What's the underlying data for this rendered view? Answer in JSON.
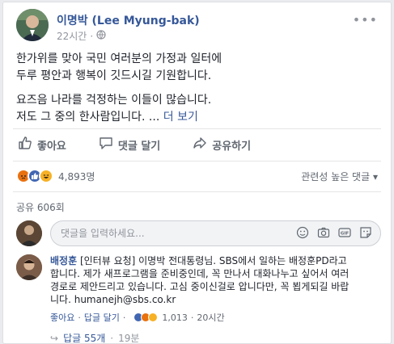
{
  "post": {
    "author": "이명박 (Lee Myung-bak)",
    "time": "22시간",
    "text_lines_p1": [
      "한가위를 맞아 국민 여러분의 가정과 일터에",
      "두루 평안과 행복이 깃드시길 기원합니다."
    ],
    "text_lines_p2": [
      "요즈음 나라를 걱정하는 이들이 많습니다."
    ],
    "text_p2_line2": "저도 그 중의 한사람입니다. ...",
    "see_more": "더 보기"
  },
  "actions": {
    "like": "좋아요",
    "comment": "댓글 달기",
    "share": "공유하기"
  },
  "reactions": {
    "count": "4,893명",
    "sort_label": "관련성 높은 댓글",
    "icons": [
      "angry-icon",
      "like-icon",
      "haha-icon"
    ],
    "colors": {
      "angry": "#e9710f",
      "like": "#4267b2",
      "haha": "#f7b125"
    }
  },
  "shares": {
    "label": "공유 606회"
  },
  "composer": {
    "placeholder": "댓글을 입력하세요...",
    "icons": [
      "emoji-icon",
      "camera-icon",
      "gif-icon",
      "sticker-icon"
    ]
  },
  "comment": {
    "name": "배정훈",
    "text": "[인터뷰 요청] 이명박 전대통령님. SBS에서 일하는 배정훈PD라고 합니다. 제가 새프로그램을 준비중인데, 꼭 만나서 대화나누고 싶어서 여러 경로로 제안드리고 있습니다. 고심 중이신걸로 압니다만, 꼭 뵙게되길 바랍니다. humanejh@sbs.co.kr",
    "text_lines": [
      "[인터뷰 요청] 이명박 전대통령님. SBS에서 일하는 배정훈PD라고",
      "합니다. 제가 새프로그램을 준비중인데, 꼭 만나서 대화나누고 싶어서 여러",
      "경로로 제안드리고 있습니다. 고심 중이신걸로 압니다만, 꼭 뵙게되길 바랍",
      "니다. humanejh@sbs.co.kr"
    ],
    "like": "좋아요",
    "reply": "답글 달기",
    "reaction_count": "1,013",
    "time": "20시간",
    "replies": "답글 55개",
    "replies_time": "19분"
  }
}
